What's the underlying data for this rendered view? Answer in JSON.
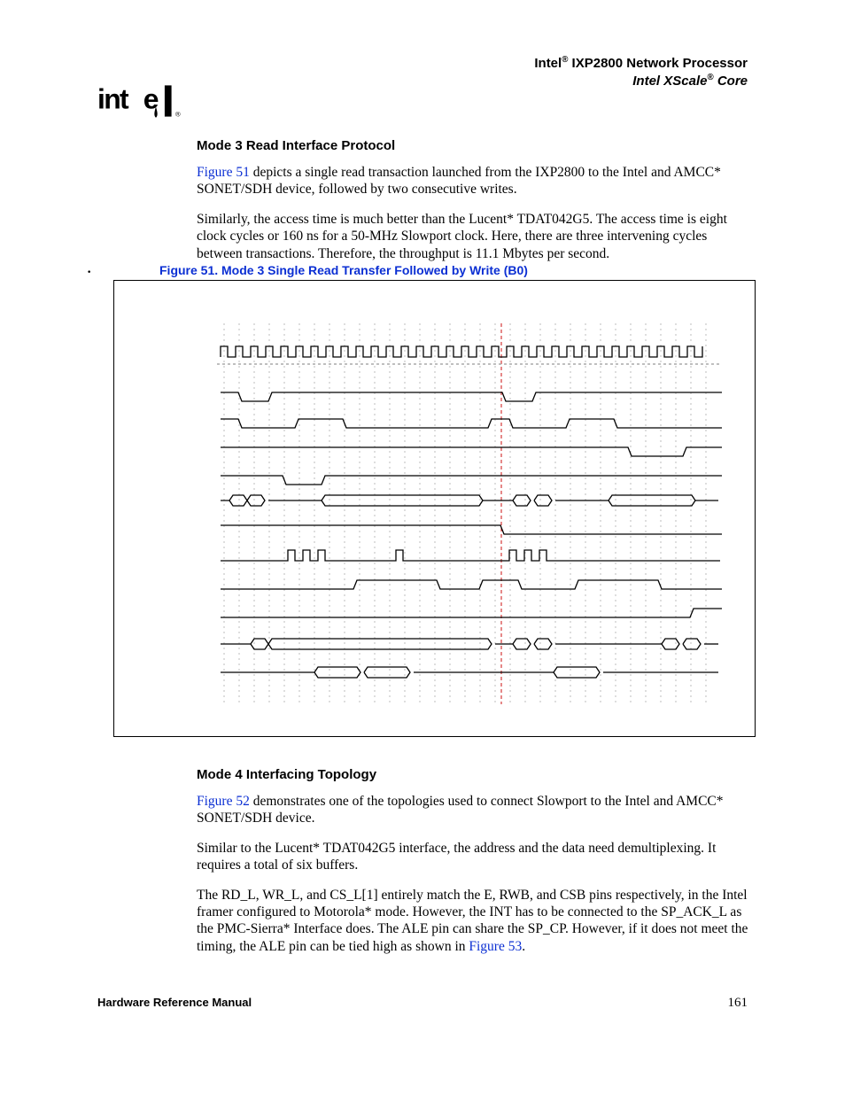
{
  "header": {
    "line1_pre": "Intel",
    "line1_sup": "®",
    "line1_post": " IXP2800 Network Processor",
    "line2_pre": "Intel XScale",
    "line2_sup": "®",
    "line2_post": " Core"
  },
  "section1": {
    "heading": "Mode 3 Read Interface Protocol",
    "para1_link": "Figure 51",
    "para1_rest": " depicts a single read transaction launched from the IXP2800 to the Intel and AMCC* SONET/SDH device, followed by two consecutive writes.",
    "para2": "Similarly, the access time is much better than the Lucent* TDAT042G5. The access time is eight clock cycles or 160 ns for a 50-MHz Slowport clock. Here, there are three intervening cycles between transactions. Therefore, the throughput is 11.1 Mbytes per second."
  },
  "figure": {
    "caption": "Figure 51. Mode 3 Single Read Transfer Followed by Write (B0)"
  },
  "section2": {
    "heading": "Mode 4 Interfacing Topology",
    "para1_link": "Figure 52",
    "para1_rest": " demonstrates one of the topologies used to connect Slowport to the Intel and AMCC* SONET/SDH device.",
    "para2": "Similar to the Lucent* TDAT042G5 interface, the address and the data need demultiplexing. It requires a total of six buffers.",
    "para3_pre": "The RD_L, WR_L, and CS_L[1] entirely match the E, RWB, and CSB pins respectively, in the Intel framer configured to Motorola* mode. However, the INT has to be connected to the SP_ACK_L as the PMC-Sierra* Interface does. The ALE pin can share the SP_CP. However, if it does not meet the timing, the ALE pin can be tied high as shown in ",
    "para3_link": "Figure 53",
    "para3_post": "."
  },
  "footer": {
    "left": "Hardware Reference Manual",
    "right": "161"
  },
  "chart_data": {
    "type": "timing-diagram",
    "title": "Mode 3 Single Read Transfer Followed by Write (B0)",
    "clock_cycles": 33,
    "red_cycle_marker": 19,
    "note": "Signal names are not labeled in the visible crop; rows depict clock, chip-select/strobe, read/write enables, address/data buses (bus-style hexagons), acknowledge and related control lines across ~33 clock ticks with a red vertical marker near cycle 19 separating the read from the two writes."
  }
}
